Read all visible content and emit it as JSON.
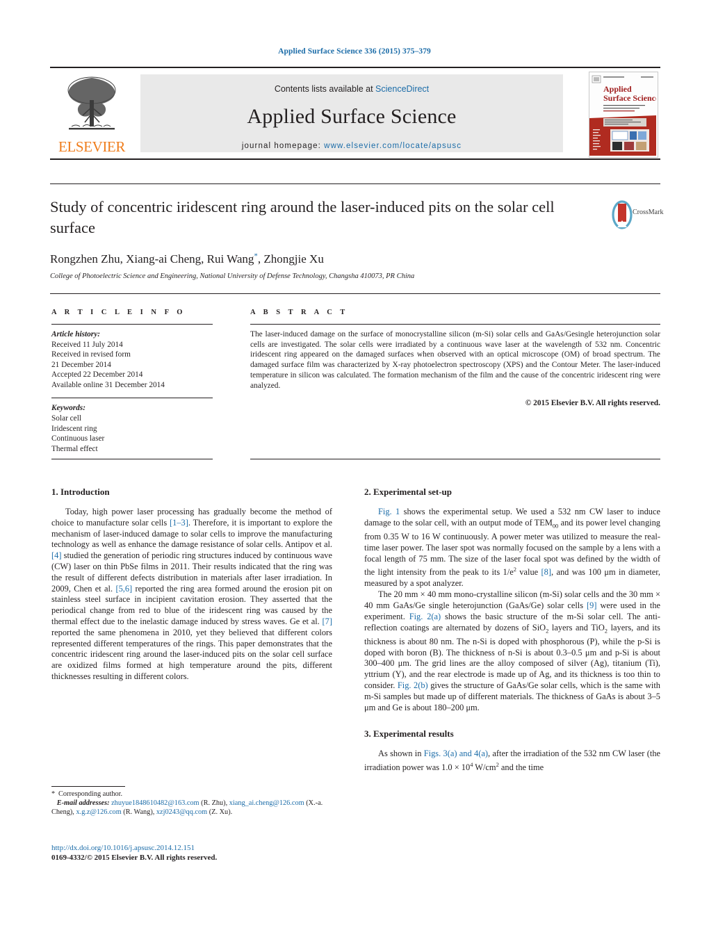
{
  "running_head": "Applied Surface Science 336 (2015) 375–379",
  "masthead": {
    "publisher": "ELSEVIER",
    "contents_prefix": "Contents lists available at ",
    "contents_link": "ScienceDirect",
    "journal_title": "Applied Surface Science",
    "homepage_prefix": "journal homepage: ",
    "homepage_url": "www.elsevier.com/locate/apsusc",
    "cover_title_line1": "Applied",
    "cover_title_line2": "Surface Science",
    "link_color": "#1b6ca8",
    "band_color": "#e9e9e9",
    "elsevier_orange": "#ef7c1b"
  },
  "article": {
    "title": "Study of concentric iridescent ring around the laser-induced pits on the solar cell surface",
    "authors_html": "Rongzhen Zhu, Xiang-ai Cheng, Rui Wang<sup>*</sup>, Zhongjie Xu",
    "affiliation": "College of Photoelectric Science and Engineering, National University of Defense Technology, Changsha 410073, PR China",
    "crossmark_label": "CrossMark"
  },
  "article_info": {
    "heading": "A R T I C L E   I N F O",
    "history_label": "Article history:",
    "history": [
      "Received 11 July 2014",
      "Received in revised form",
      "21 December 2014",
      "Accepted 22 December 2014",
      "Available online 31 December 2014"
    ],
    "keywords_label": "Keywords:",
    "keywords": [
      "Solar cell",
      "Iridescent ring",
      "Continuous laser",
      "Thermal effect"
    ]
  },
  "abstract": {
    "heading": "A B S T R A C T",
    "text": "The laser-induced damage on the surface of monocrystalline silicon (m-Si) solar cells and GaAs/Gesingle heterojunction solar cells are investigated. The solar cells were irradiated by a continuous wave laser at the wavelength of 532 nm. Concentric iridescent ring appeared on the damaged surfaces when observed with an optical microscope (OM) of broad spectrum. The damaged surface film was characterized by X-ray photoelectron spectroscopy (XPS) and the Contour Meter. The laser-induced temperature in silicon was calculated. The formation mechanism of the film and the cause of the concentric iridescent ring were analyzed.",
    "copyright": "© 2015 Elsevier B.V. All rights reserved."
  },
  "sections": {
    "intro_heading": "1.  Introduction",
    "intro_paragraph_1": "Today, high power laser processing has gradually become the method of choice to manufacture solar cells [1–3]. Therefore, it is important to explore the mechanism of laser-induced damage to solar cells to improve the manufacturing technology as well as enhance the damage resistance of solar cells. Antipov et al. [4] studied the generation of periodic ring structures induced by continuous wave (CW) laser on thin PbSe films in 2011. Their results indicated that the ring was the result of different defects distribution in materials after laser irradiation. In 2009, Chen et al. [5,6] reported the ring area formed around the erosion pit on stainless steel surface in incipient cavitation erosion. They asserted that the periodical change from red to blue of the iridescent ring was caused by the thermal effect due to the inelastic damage induced by stress waves. Ge et al. [7] reported the same phenomena in 2010, yet they believed that different colors represented different temperatures of the rings. This paper demonstrates that the concentric iridescent ring around the laser-induced pits on the solar cell surface are oxidized films formed at high temperature around the pits, different thicknesses resulting in different colors.",
    "setup_heading": "2.  Experimental set-up",
    "setup_paragraph_1": "Fig. 1 shows the experimental setup. We used a 532 nm CW laser to induce damage to the solar cell, with an output mode of TEM00 and its power level changing from 0.35 W to 16 W continuously. A power meter was utilized to measure the real-time laser power. The laser spot was normally focused on the sample by a lens with a focal length of 75 mm. The size of the laser focal spot was defined by the width of the light intensity from the peak to its 1/e2 value [8], and was 100 μm in diameter, measured by a spot analyzer.",
    "setup_paragraph_2": "The 20 mm × 40 mm mono-crystalline silicon (m-Si) solar cells and the 30 mm × 40 mm GaAs/Ge single heterojunction (GaAs/Ge) solar cells [9] were used in the experiment. Fig. 2(a) shows the basic structure of the m-Si solar cell. The anti-reflection coatings are alternated by dozens of SiO2 layers and TiO2 layers, and its thickness is about 80 nm. The n-Si is doped with phosphorous (P), while the p-Si is doped with boron (B). The thickness of n-Si is about 0.3–0.5 μm and p-Si is about 300–400 μm. The grid lines are the alloy composed of silver (Ag), titanium (Ti), yttrium (Y), and the rear electrode is made up of Ag, and its thickness is too thin to consider. Fig. 2(b) gives the structure of GaAs/Ge solar cells, which is the same with m-Si samples but made up of different materials. The thickness of GaAs is about 3–5 μm and Ge is about 180–200 μm.",
    "results_heading": "3.  Experimental results",
    "results_paragraph_1": "As shown in Figs. 3(a) and 4(a), after the irradiation of the 532 nm CW laser (the irradiation power was 1.0 × 104 W/cm2 and the time"
  },
  "footnotes": {
    "corresponding": "Corresponding author.",
    "email_label": "E-mail addresses:",
    "email_1": "zhuyue1848610482@163.com",
    "email_1_owner": "(R. Zhu),",
    "email_2": "xiang_ai.cheng@126.com",
    "email_2_owner": "(X.-a. Cheng),",
    "email_3": "x.g.z@126.com",
    "email_3_owner": "(R. Wang),",
    "email_4": "xzj0243@qq.com",
    "email_4_owner": "(Z. Xu).",
    "doi": "http://dx.doi.org/10.1016/j.apsusc.2014.12.151",
    "issn": "0169-4332/© 2015 Elsevier B.V. All rights reserved."
  }
}
